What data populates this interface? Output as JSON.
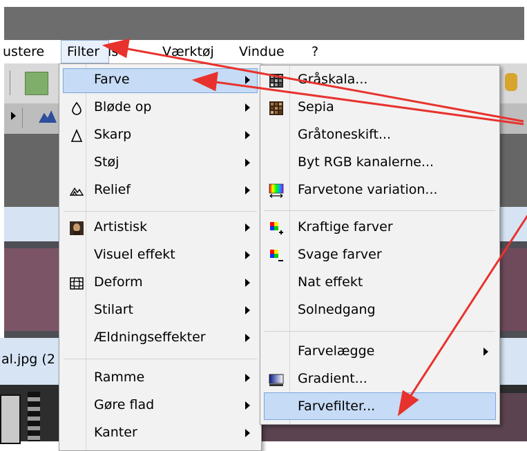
{
  "menubar": {
    "items": [
      {
        "label": "ustere"
      },
      {
        "label": "Filter"
      },
      {
        "label": "is"
      },
      {
        "label": "Værktøj"
      },
      {
        "label": "Vindue"
      },
      {
        "label": "?"
      }
    ]
  },
  "filter_menu": {
    "items": [
      {
        "label": "Farve",
        "icon": "none",
        "submenu": true,
        "highlighted": true
      },
      {
        "label": "Bløde op",
        "icon": "drop-icon",
        "submenu": true
      },
      {
        "label": "Skarp",
        "icon": "triangle-icon",
        "submenu": true
      },
      {
        "label": "Støj",
        "icon": "none",
        "submenu": true
      },
      {
        "label": "Relief",
        "icon": "relief-icon",
        "submenu": true
      },
      {
        "label": "Artistisk",
        "icon": "portrait-icon",
        "submenu": true
      },
      {
        "label": "Visuel effekt",
        "icon": "none",
        "submenu": true
      },
      {
        "label": "Deform",
        "icon": "grid-deform-icon",
        "submenu": true
      },
      {
        "label": "Stilart",
        "icon": "none",
        "submenu": true
      },
      {
        "label": "Ældningseffekter",
        "icon": "none",
        "submenu": true
      },
      {
        "label": "Ramme",
        "icon": "none",
        "submenu": true
      },
      {
        "label": "Gøre flad",
        "icon": "none",
        "submenu": true
      },
      {
        "label": "Kanter",
        "icon": "none",
        "submenu": true
      }
    ]
  },
  "farve_menu": {
    "items": [
      {
        "label": "Gråskala...",
        "icon": "grayscale-grid-icon"
      },
      {
        "label": "Sepia",
        "icon": "sepia-grid-icon"
      },
      {
        "label": "Gråtoneskift...",
        "icon": "none"
      },
      {
        "label": "Byt RGB kanalerne...",
        "icon": "none"
      },
      {
        "label": "Farvetone variation...",
        "icon": "rainbow-icon"
      },
      {
        "label": "Kraftige farver",
        "icon": "color-plus-icon"
      },
      {
        "label": "Svage farver",
        "icon": "color-minus-icon"
      },
      {
        "label": "Nat effekt",
        "icon": "none"
      },
      {
        "label": "Solnedgang",
        "icon": "none"
      },
      {
        "label": "Farvelægge",
        "icon": "none",
        "submenu": true
      },
      {
        "label": "Gradient...",
        "icon": "gradient-icon"
      },
      {
        "label": "Farvefilter...",
        "icon": "none",
        "highlighted": true
      }
    ]
  },
  "background": {
    "file_label": "al.jpg (2"
  },
  "colors": {
    "highlight": "#c6dbf5",
    "highlight_border": "#7aa6dc",
    "annotation_arrow": "#e8322d",
    "title_bar": "#6d6d6d"
  }
}
